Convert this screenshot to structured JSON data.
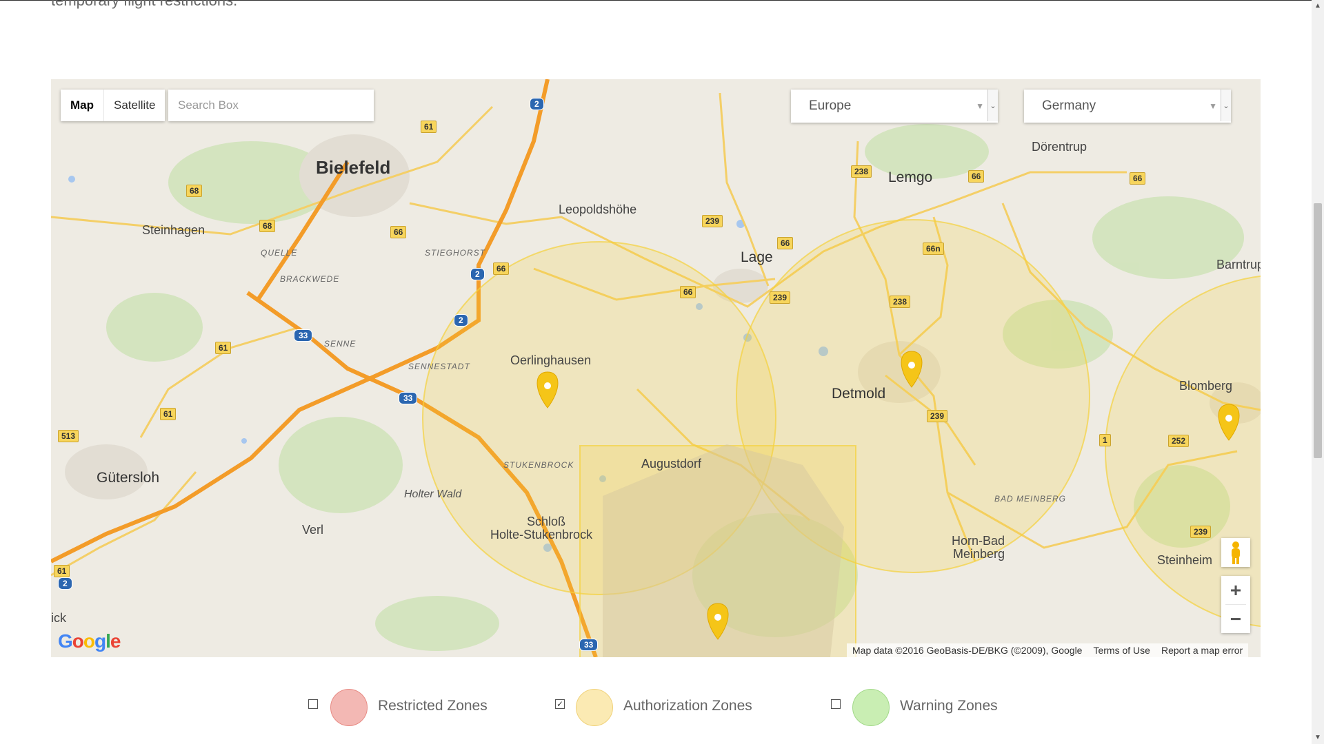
{
  "page": {
    "intro_text": "temporary flight restrictions."
  },
  "map": {
    "type_control": {
      "map_label": "Map",
      "satellite_label": "Satellite"
    },
    "search": {
      "placeholder": "Search Box"
    },
    "region_select": {
      "selected": "Europe"
    },
    "country_select": {
      "selected": "Germany"
    },
    "cities": {
      "bielefeld": "Bielefeld",
      "lemgo": "Lemgo",
      "dorentrup": "Dörentrup",
      "steinhagen": "Steinhagen",
      "leopoldshohe": "Leopoldshöhe",
      "lage": "Lage",
      "barntrup": "Barntrup",
      "oerlinghausen": "Oerlinghausen",
      "detmold": "Detmold",
      "blomberg": "Blomberg",
      "gutersloh": "Gütersloh",
      "augustdorf": "Augustdorf",
      "schloss": "Schloß",
      "holte": "Holte-Stukenbrock",
      "verl": "Verl",
      "horn_bad": "Horn-Bad",
      "meinberg": "Meinberg",
      "steinheim": "Steinheim",
      "ick": "ick"
    },
    "districts": {
      "quelle": "QUELLE",
      "brackwede": "BRACKWEDE",
      "stieghorst": "STIEGHORST",
      "senne": "SENNE",
      "sennestadt": "SENNESTADT",
      "stukenbrock": "STUKENBROCK",
      "bad_meinberg": "BAD MEINBERG"
    },
    "places": {
      "holter_wald": "Holter Wald"
    },
    "routes": {
      "r61a": "61",
      "r68a": "68",
      "r68b": "68",
      "r66a": "66",
      "r66b": "66",
      "r66c": "66",
      "r66d": "66",
      "r66e": "66",
      "r66f": "66",
      "r238a": "238",
      "r238b": "238",
      "r239a": "239",
      "r239b": "239",
      "r239c": "239",
      "r239d": "239",
      "r66n": "66n",
      "r61b": "61",
      "r61c": "61",
      "r61d": "61",
      "r513": "513",
      "r252": "252",
      "r1": "1"
    },
    "autobahn": {
      "a2a": "2",
      "a2b": "2",
      "a2c": "2",
      "a2d": "2",
      "a33a": "33",
      "a33b": "33",
      "a33c": "33"
    },
    "google_logo": "Google",
    "attribution": {
      "map_data": "Map data ©2016 GeoBasis-DE/BKG (©2009), Google",
      "terms": "Terms of Use",
      "report": "Report a map error"
    },
    "zoom_in": "+",
    "zoom_out": "−",
    "zone_color": "#f5d23c"
  },
  "legend": [
    {
      "label": "Restricted Zones",
      "checked": false,
      "color": "#f3b8b4"
    },
    {
      "label": "Authorization Zones",
      "checked": true,
      "color": "#fbeab3"
    },
    {
      "label": "Warning Zones",
      "checked": false,
      "color": "#c9eeb3"
    }
  ]
}
